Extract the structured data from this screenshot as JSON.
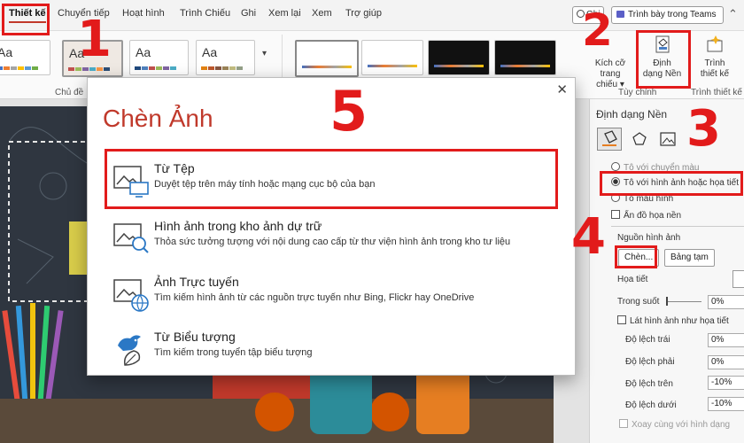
{
  "ribbon_tabs": [
    "Thiết kế",
    "Chuyển tiếp",
    "Hoạt hình",
    "Trình Chiếu",
    "Ghi",
    "Xem lại",
    "Xem",
    "Trợ giúp"
  ],
  "top_right": {
    "record_label": "Ghi",
    "teams_label": "Trình bày trong Teams"
  },
  "themes": {
    "sample_text": "Aa",
    "group_label": "Chủ đề"
  },
  "ribbon_buttons": {
    "slide_size_1": "Kích cỡ trang",
    "slide_size_2": "chiếu",
    "format_bg_1": "Định",
    "format_bg_2": "dạng Nền",
    "designer_1": "Trình",
    "designer_2": "thiết kế",
    "customize_group": "Tùy chỉnh",
    "designer_group": "Trình thiết kế"
  },
  "dialog": {
    "title": "Chèn Ảnh",
    "close_glyph": "✕",
    "options": [
      {
        "title": "Từ Tệp",
        "desc": "Duyệt tệp trên máy tính hoặc mạng cục bộ của bạn"
      },
      {
        "title": "Hình ảnh trong kho ảnh dự trữ",
        "desc": "Thỏa sức tưởng tượng với nội dung cao cấp từ thư viện hình ảnh trong kho tư liệu"
      },
      {
        "title": "Ảnh Trực tuyến",
        "desc": "Tìm kiếm hình ảnh từ các nguồn trực tuyến như Bing, Flickr hay OneDrive"
      },
      {
        "title": "Từ Biểu tượng",
        "desc": "Tìm kiếm trong tuyển tập biểu tượng"
      }
    ]
  },
  "pane": {
    "title": "Định dạng Nền",
    "fill_gradient": "Tô với chuyển màu",
    "fill_picture": "Tô với hình ảnh hoặc họa tiết",
    "fill_pattern": "Tô mẫu hình",
    "hide_graphics": "Ẩn đồ họa nền",
    "source_label": "Nguồn hình ảnh",
    "insert_button": "Chèn...",
    "clipboard_button": "Bảng tạm",
    "texture_label": "Họa tiết",
    "transparency_label": "Trong suốt",
    "transparency_value": "0%",
    "tile_label": "Lát hình ảnh như họa tiết",
    "offset_left_label": "Độ lệch trái",
    "offset_left_value": "0%",
    "offset_right_label": "Độ lệch phải",
    "offset_right_value": "0%",
    "offset_top_label": "Độ lệch trên",
    "offset_top_value": "-10%",
    "offset_bottom_label": "Độ lệch dưới",
    "offset_bottom_value": "-10%",
    "rotate_label": "Xoay cùng với hình dạng"
  },
  "step_numbers": [
    "1",
    "2",
    "3",
    "4",
    "5"
  ],
  "colors": {
    "accent": "#c0392b",
    "annotation": "#e21b1b",
    "dialog_title": "#c0392b"
  }
}
